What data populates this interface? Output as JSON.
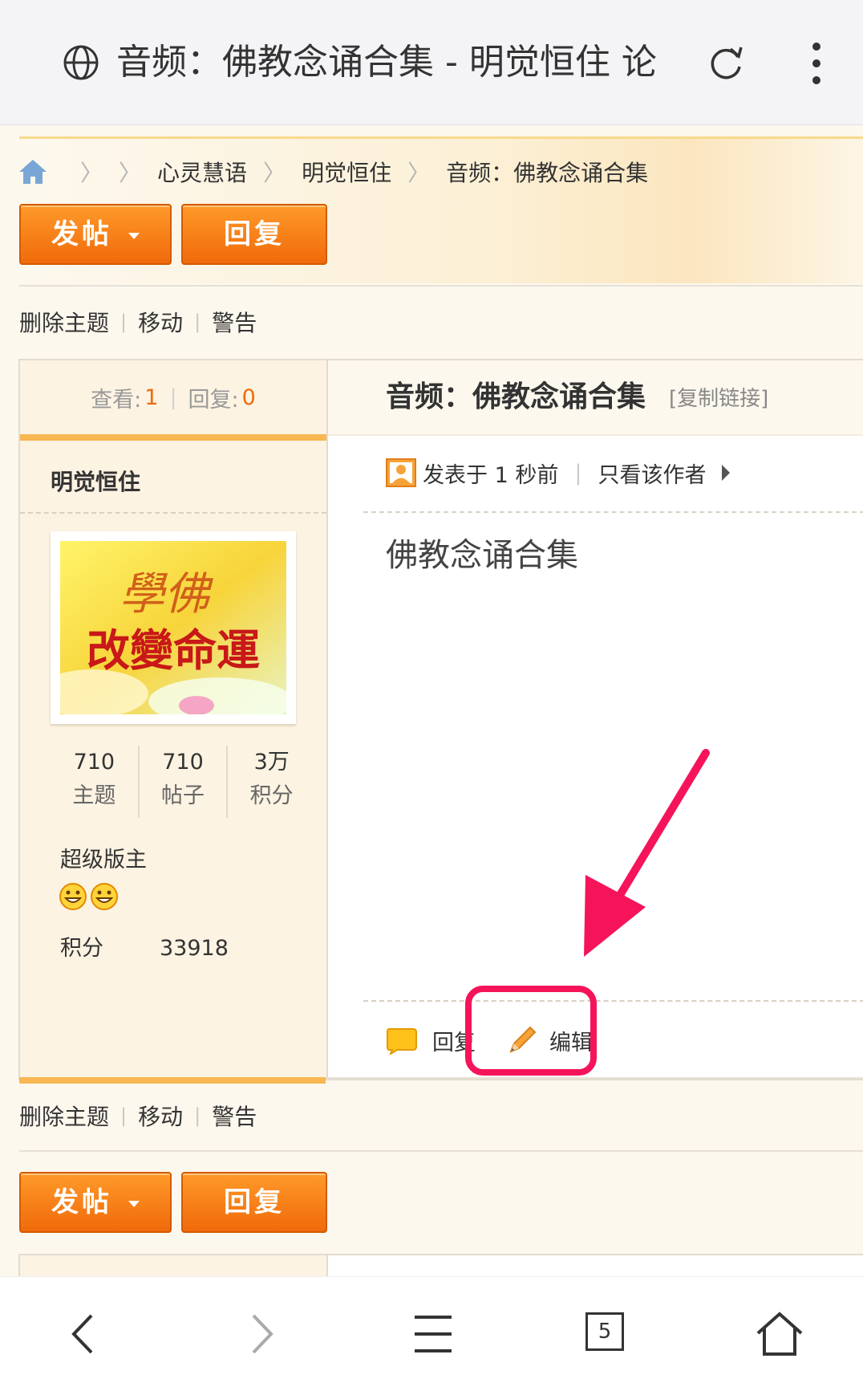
{
  "browser": {
    "title": "音频：佛教念诵合集 - 明觉恒住 论",
    "tab_count": "5"
  },
  "breadcrumb": {
    "items": [
      "心灵慧语",
      "明觉恒住",
      "音频：佛教念诵合集"
    ]
  },
  "buttons": {
    "post": "发帖",
    "reply": "回复"
  },
  "moderation": {
    "delete": "删除主题",
    "move": "移动",
    "warn": "警告"
  },
  "thread": {
    "views_label": "查看:",
    "views": "1",
    "replies_label": "回复:",
    "replies": "0",
    "title": "音频：佛教念诵合集",
    "copy_link": "[复制链接]"
  },
  "author": {
    "name": "明觉恒住",
    "avatar_text_top": "學佛",
    "avatar_text_bottom": "改變命運",
    "stats": [
      {
        "value": "710",
        "label": "主题"
      },
      {
        "value": "710",
        "label": "帖子"
      },
      {
        "value": "3万",
        "label": "积分"
      }
    ],
    "group": "超级版主",
    "credit_label": "积分",
    "credit_value": "33918"
  },
  "post": {
    "posted_at": "发表于 1 秒前",
    "only_author": "只看该作者",
    "content": "佛教念诵合集",
    "reply_action": "回复",
    "edit_action": "编辑"
  },
  "colors": {
    "accent_orange": "#f06a0a",
    "annotation": "#f5145a"
  },
  "icons": [
    "globe-icon",
    "reload-icon",
    "more-icon",
    "home-icon",
    "user-icon",
    "play-icon",
    "bubble-icon",
    "pencil-icon",
    "back-icon",
    "forward-icon",
    "menu-icon",
    "tabs-icon",
    "house-icon"
  ]
}
